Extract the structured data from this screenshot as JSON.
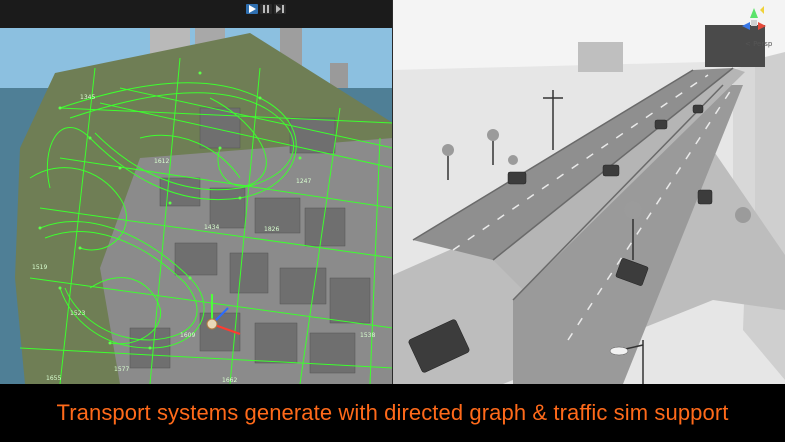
{
  "toolbar": {
    "buttons": [
      {
        "icon": "play-icon",
        "active": true
      },
      {
        "icon": "pause-icon",
        "active": false
      },
      {
        "icon": "step-icon",
        "active": false
      }
    ]
  },
  "scene_view": {
    "node_labels": [
      "1655",
      "1662",
      "1577",
      "1434",
      "1826",
      "1523",
      "1345",
      "1247",
      "1612",
      "1519",
      "1538",
      "1609"
    ]
  },
  "game_view": {
    "projection_label": "< Persp"
  },
  "caption": {
    "text": "Transport systems generate with directed graph & traffic sim support",
    "color": "#ff6a1a"
  }
}
